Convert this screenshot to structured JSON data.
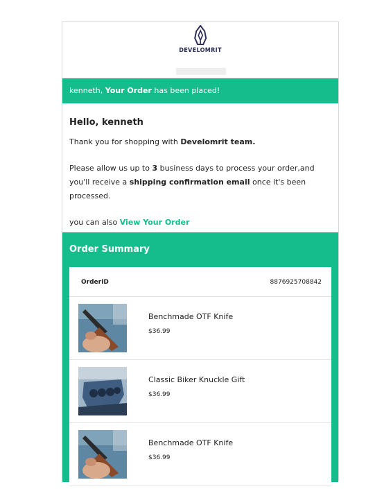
{
  "brand": {
    "name": "DEVELOMRIT"
  },
  "banner": {
    "name": "kenneth,",
    "emphasis": "Your Order",
    "rest": "has been placed!"
  },
  "greeting": {
    "hello": "Hello, kenneth",
    "thanks_prefix": "Thank you for shopping with",
    "thanks_team": "Develomrit team.",
    "allow_prefix": "Please allow us up to",
    "days": "3",
    "allow_mid": "business days to process your order,and you'll receive a",
    "shipping_email": "shipping confirmation email",
    "allow_suffix": "once it's been processed.",
    "also_prefix": "you can also",
    "view_order_link": "View Your Order"
  },
  "summary": {
    "title": "Order Summary",
    "order_id_label": "OrderID",
    "order_id_value": "8876925708842",
    "items": [
      {
        "name": "Benchmade OTF Knife",
        "price": "$36.99",
        "image_icon": "knife-photo-icon"
      },
      {
        "name": "Classic Biker Knuckle Gift",
        "price": "$36.99",
        "image_icon": "knuckle-photo-icon"
      },
      {
        "name": "Benchmade OTF Knife",
        "price": "$36.99",
        "image_icon": "knife-photo-icon"
      }
    ]
  },
  "colors": {
    "accent": "#14bd8b",
    "logo": "#2e2e5a"
  }
}
